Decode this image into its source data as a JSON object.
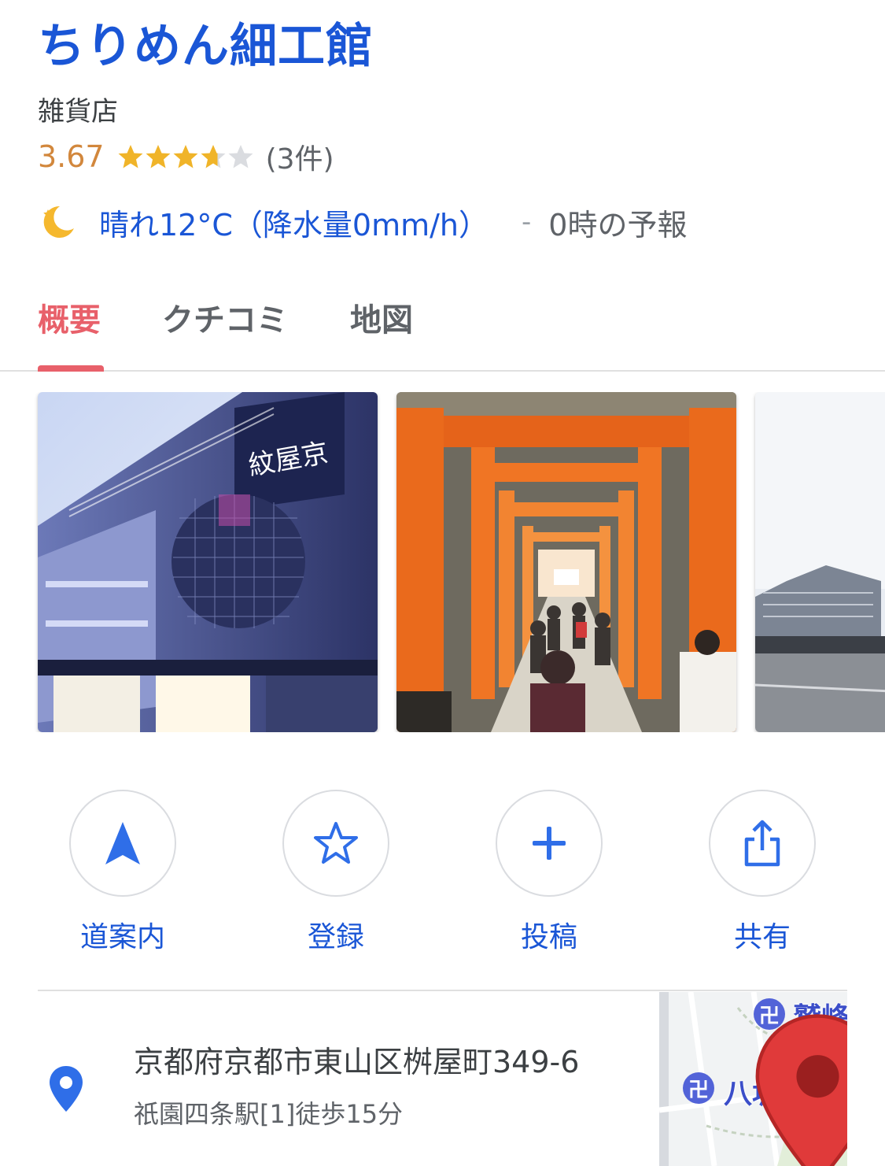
{
  "place": {
    "name": "ちりめん細工館",
    "category": "雑貨店",
    "rating": "3.67",
    "rating_stars": 3.67,
    "review_count": "(3件)"
  },
  "weather": {
    "icon": "crescent-moon-icon",
    "text": "晴れ12°C（降水量0mm/h）",
    "separator": "-",
    "forecast_time": "0時の予報"
  },
  "tabs": [
    {
      "label": "概要",
      "active": true
    },
    {
      "label": "クチコミ",
      "active": false
    },
    {
      "label": "地図",
      "active": false
    }
  ],
  "photos": [
    {
      "subject": "shop-building-photo"
    },
    {
      "subject": "torii-gate-tunnel-photo"
    },
    {
      "subject": "station-building-photo"
    }
  ],
  "actions": [
    {
      "label": "道案内",
      "icon": "navigation-arrow-icon"
    },
    {
      "label": "登録",
      "icon": "star-outline-icon"
    },
    {
      "label": "投稿",
      "icon": "plus-icon"
    },
    {
      "label": "共有",
      "icon": "share-icon"
    }
  ],
  "address": {
    "line": "京都府京都市東山区桝屋町349-6",
    "access": "祇園四条駅[1]徒歩15分"
  },
  "map": {
    "labels": [
      "鷲峰",
      "八坂庚申"
    ],
    "temple_symbol": "卍"
  },
  "colors": {
    "link_blue": "#1a56d6",
    "accent_pink": "#e8606a",
    "star_gold": "#f0b429",
    "star_empty": "#dadce0",
    "rating_orange": "#d2873c",
    "map_pin_red": "#e03a3a"
  }
}
